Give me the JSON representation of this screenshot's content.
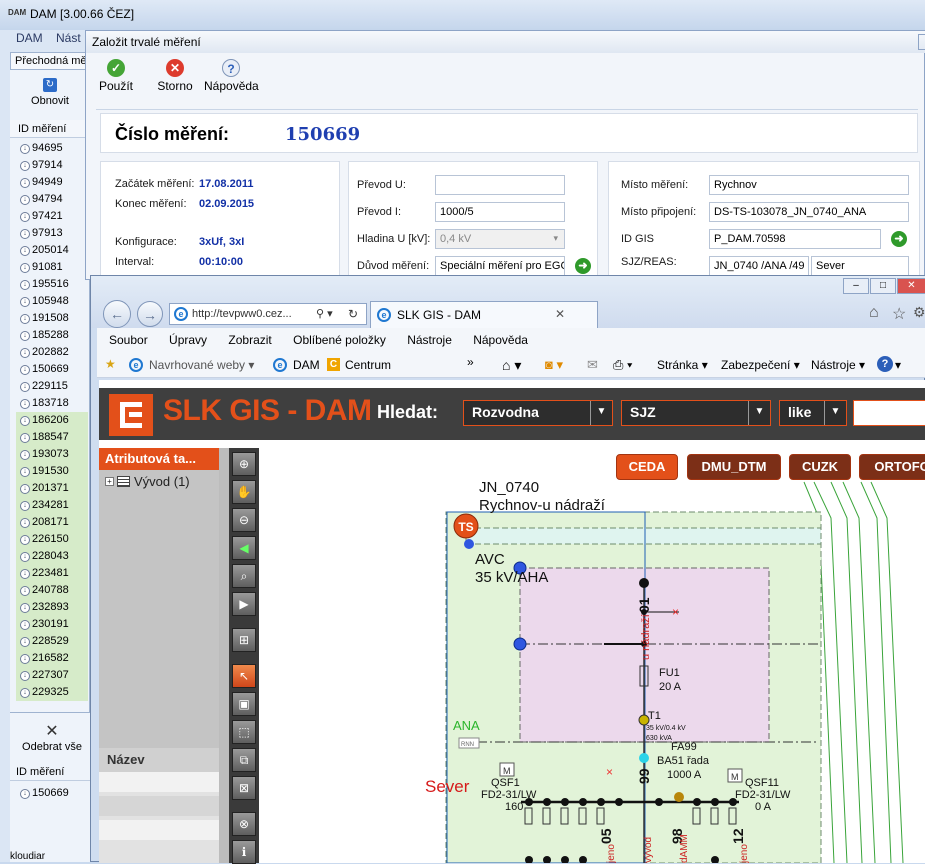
{
  "dam": {
    "window_title": "DAM [3.00.66 ČEZ]",
    "app_icon": "DAM",
    "menu": [
      "DAM",
      "Nást"
    ],
    "tab": "Přechodná mě",
    "refresh_label": "Obnovit",
    "id_header": "ID měření",
    "ids": [
      {
        "id": "94695",
        "green": false
      },
      {
        "id": "97914",
        "green": false
      },
      {
        "id": "94949",
        "green": false
      },
      {
        "id": "94794",
        "green": false
      },
      {
        "id": "97421",
        "green": false
      },
      {
        "id": "97913",
        "green": false
      },
      {
        "id": "205014",
        "green": false
      },
      {
        "id": "91081",
        "green": false
      },
      {
        "id": "195516",
        "green": false
      },
      {
        "id": "105948",
        "green": false
      },
      {
        "id": "191508",
        "green": false
      },
      {
        "id": "185288",
        "green": false
      },
      {
        "id": "202882",
        "green": false
      },
      {
        "id": "150669",
        "green": false
      },
      {
        "id": "229115",
        "green": false
      },
      {
        "id": "183718",
        "green": false
      },
      {
        "id": "186206",
        "green": true
      },
      {
        "id": "188547",
        "green": true
      },
      {
        "id": "193073",
        "green": true
      },
      {
        "id": "191530",
        "green": true
      },
      {
        "id": "201371",
        "green": true
      },
      {
        "id": "234281",
        "green": true
      },
      {
        "id": "208171",
        "green": true
      },
      {
        "id": "226150",
        "green": true
      },
      {
        "id": "228043",
        "green": true
      },
      {
        "id": "223481",
        "green": true
      },
      {
        "id": "240788",
        "green": true
      },
      {
        "id": "232893",
        "green": true
      },
      {
        "id": "230191",
        "green": true
      },
      {
        "id": "228529",
        "green": true
      },
      {
        "id": "216582",
        "green": true
      },
      {
        "id": "227307",
        "green": true
      },
      {
        "id": "229325",
        "green": true
      }
    ],
    "remove_all_label": "Odebrat vše",
    "selected_header": "ID měření",
    "selected_id": "150669",
    "footer_text": "kloudiar"
  },
  "dialog": {
    "title": "Založit trvalé měření",
    "toolbar": {
      "apply": "Použít",
      "cancel": "Storno",
      "help": "Nápověda"
    },
    "number_label": "Číslo měření:",
    "number_value": "150669",
    "left": {
      "start_label": "Začátek měření:",
      "start_value": "17.08.2011",
      "end_label": "Konec měření:",
      "end_value": "02.09.2015",
      "config_label": "Konfigurace:",
      "config_value": "3xUf, 3xI",
      "interval_label": "Interval:",
      "interval_value": "00:10:00"
    },
    "middle": {
      "u_label": "Převod U:",
      "u_value": "",
      "i_label": "Převod I:",
      "i_value": "1000/5",
      "level_label": "Hladina U [kV]:",
      "level_value": "0,4 kV",
      "reason_label": "Důvod měření:",
      "reason_value": "Speciální měření pro EGC Č"
    },
    "right": {
      "place_label": "Místo měření:",
      "place_value": "Rychnov",
      "conn_label": "Místo připojení:",
      "conn_value": "DS-TS-103078_JN_0740_ANA",
      "gis_label": "ID GIS",
      "gis_value": "P_DAM.70598",
      "sjz_label": "SJZ/REAS:",
      "sjz_value": "JN_0740 /ANA /49",
      "reas_value": "Sever"
    }
  },
  "ie": {
    "address": "http://tevpww0.cez...",
    "tab_title": "SLK GIS - DAM",
    "menu": [
      "Soubor",
      "Úpravy",
      "Zobrazit",
      "Oblíbené položky",
      "Nástroje",
      "Nápověda"
    ],
    "fav": {
      "suggested": "Navrhované weby",
      "dam": "DAM",
      "centrum": "Centrum",
      "chevron": "»"
    },
    "cmd": {
      "page": "Stránka",
      "security": "Zabezpečení",
      "tools": "Nástroje"
    }
  },
  "gis": {
    "title": "SLK GIS - DAM",
    "search_label": "Hledat:",
    "select1": "Rozvodna",
    "select2": "SJZ",
    "select3": "like",
    "attr_header": "Atributová ta...",
    "tree_item": "Vývod (1)",
    "name_header": "Název",
    "layers": [
      "CEDA",
      "DMU_DTM",
      "CUZK",
      "ORTOFOTO"
    ],
    "map": {
      "station_name": "JN_0740",
      "station_place": "Rychnov-u nádraží",
      "ts": "TS",
      "avc1": "AVC",
      "avc2": "35 kV/AHA",
      "n01": "01",
      "nadrazi": "u nádraží",
      "fu1": "FU1",
      "fu1_val": "20 A",
      "t1": "T1",
      "t1_spec1": "35 kV/0.4 kV",
      "t1_spec2": "630 kVA",
      "ana": "ANA",
      "rnn": "RNN",
      "fa99": "FA99",
      "ba51": "BA51 řada",
      "amp1000": "1000 A",
      "sever": "Sever",
      "qsf1": "QSF1",
      "fd1": "FD2-31/LW",
      "v160": "160",
      "qsf11": "QSF11",
      "fd2": "FD2-31/LW",
      "v0a": "0 A",
      "m": "M",
      "n99": "99",
      "n05": "05",
      "n98": "98",
      "n12": "12",
      "vyvod": "vývod",
      "jeno": "jeno",
      "dmm": "dAMM"
    }
  }
}
